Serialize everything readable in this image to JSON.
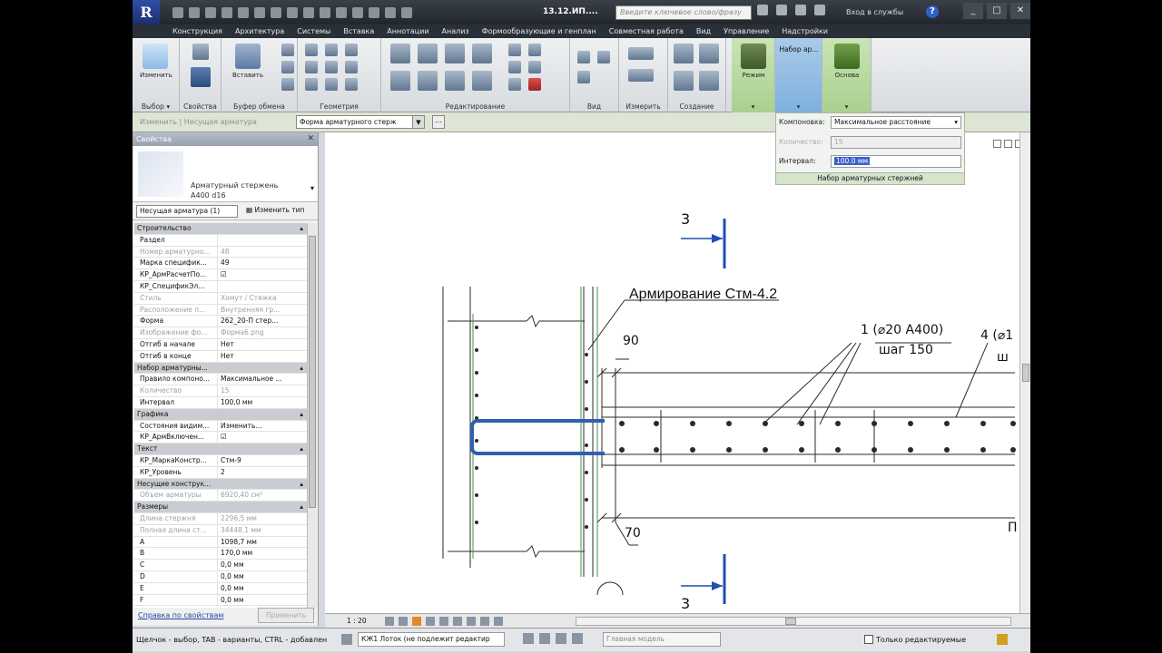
{
  "title": {
    "doc": "13.12.ИП....",
    "search_placeholder": "Введите ключевое слово/фразу",
    "signin": "Вход в службы",
    "win_min": "_",
    "win_max": "□",
    "win_close": "✕"
  },
  "tabs": [
    "Конструкция",
    "Архитектура",
    "Системы",
    "Вставка",
    "Аннотации",
    "Анализ",
    "Формообразующие и генплан",
    "Совместная работа",
    "Вид",
    "Управление",
    "Надстройки"
  ],
  "ribbon": {
    "modify_label": "Изменить",
    "select_label": "Выбор ▾",
    "properties_label": "Свойства",
    "paste_label": "Вставить",
    "clipboard_label": "Буфер обмена",
    "geometry_label": "Геометрия",
    "editing_label": "Редактирование",
    "view_label": "Вид",
    "measure_label": "Измерить",
    "create_label": "Создание",
    "mode_label": "Режим",
    "set_label": "Набор ар...",
    "host_label": "Основа"
  },
  "options_bar": {
    "crumb": "Изменить | Несущая арматура",
    "form_value": "Форма арматурного стерж"
  },
  "set_panel": {
    "layout_label": "Компоновка:",
    "layout_value": "Максимальное расстояние",
    "quantity_label": "Количество:",
    "quantity_value": "15",
    "interval_label": "Интервал:",
    "interval_value": "100.0 мм",
    "footer": "Набор арматурных стержней"
  },
  "properties": {
    "title": "Свойства",
    "close": "✕",
    "type_name_1": "Арматурный стержень",
    "type_name_2": "А400 d16",
    "filter": "Несущая арматура (1)",
    "edit_type": "Изменить тип",
    "rows": [
      {
        "k": "Строительство",
        "v": "",
        "group": true
      },
      {
        "k": "Раздел",
        "v": ""
      },
      {
        "k": "Номер арматурно...",
        "v": "48",
        "gray": true
      },
      {
        "k": "Марка специфик...",
        "v": "49"
      },
      {
        "k": "КР_АрмРасчетПо...",
        "v": "☑"
      },
      {
        "k": "КР_СпецификЭл...",
        "v": ""
      },
      {
        "k": "Стиль",
        "v": "Хомут / Стяжка",
        "gray": true
      },
      {
        "k": "Расположение п...",
        "v": "Внутренняя гр...",
        "gray": true
      },
      {
        "k": "Форма",
        "v": "262_20-П стер..."
      },
      {
        "k": "Изображение фо...",
        "v": "Форма6.png",
        "gray": true
      },
      {
        "k": "Отгиб в начале",
        "v": "Нет"
      },
      {
        "k": "Отгиб в конце",
        "v": "Нет"
      },
      {
        "k": "Набор арматурны...",
        "v": "",
        "group": true
      },
      {
        "k": "Правило компоно...",
        "v": "Максимальное ..."
      },
      {
        "k": "Количество",
        "v": "15",
        "gray": true
      },
      {
        "k": "Интервал",
        "v": "100,0 мм"
      },
      {
        "k": "Графика",
        "v": "",
        "group": true
      },
      {
        "k": "Состояния видим...",
        "v": "Изменить..."
      },
      {
        "k": "КР_АрмВключен...",
        "v": "☑"
      },
      {
        "k": "Текст",
        "v": "",
        "group": true
      },
      {
        "k": "КР_МаркаКонстр...",
        "v": "Стм-9"
      },
      {
        "k": "КР_Уровень",
        "v": "2"
      },
      {
        "k": "Несущие конструк...",
        "v": "",
        "group": true
      },
      {
        "k": "Объем арматуры",
        "v": "6920,40 см³",
        "gray": true
      },
      {
        "k": "Размеры",
        "v": "",
        "group": true
      },
      {
        "k": "Длина стержня",
        "v": "2296,5 мм",
        "gray": true
      },
      {
        "k": "Полная длина ст...",
        "v": "34448,1 мм",
        "gray": true
      },
      {
        "k": "A",
        "v": "1098,7 мм"
      },
      {
        "k": "B",
        "v": "170,0 мм"
      },
      {
        "k": "C",
        "v": "0,0 мм"
      },
      {
        "k": "D",
        "v": "0,0 мм"
      },
      {
        "k": "E",
        "v": "0,0 мм"
      },
      {
        "k": "F",
        "v": "0,0 мм"
      }
    ],
    "help_link": "Справка по свойствам",
    "apply": "Применить"
  },
  "drawing": {
    "section_top": "3",
    "section_bottom": "3",
    "title_note": "Армирование Стм-4.2",
    "dim_90": "90",
    "dim_70": "70",
    "callout_1a": "1 (⌀20 А400)",
    "callout_1b": "шаг 150",
    "callout_4a": "4 (⌀1",
    "callout_4b": "ш",
    "right_edge": "П"
  },
  "view_control": {
    "scale": "1 : 20"
  },
  "status": {
    "text": "Щелчок - выбор, TAB - варианты, CTRL - добавлен",
    "workset": "КЖ1 Лоток (не подлежит редактир",
    "design_option": "Главная модель",
    "editable_only": "Только редактируемые"
  }
}
